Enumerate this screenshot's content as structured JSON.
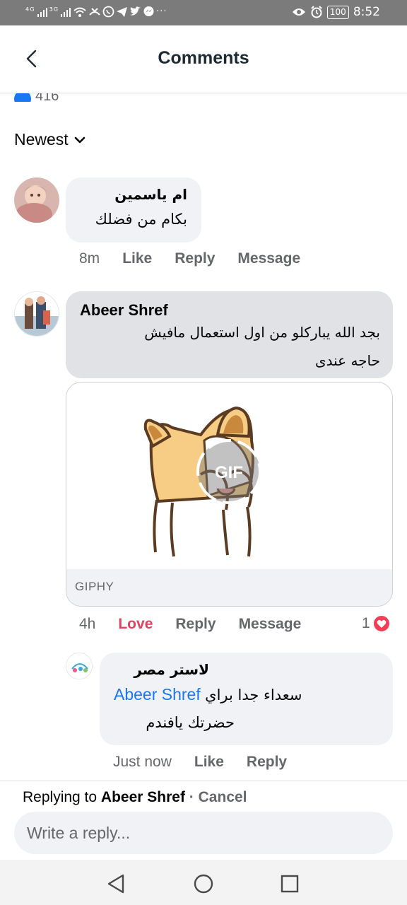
{
  "status_bar": {
    "network_left": "⁴ᴳ",
    "network_right": "³ᴳ",
    "battery": "100",
    "time": "8:52"
  },
  "header": {
    "title": "Comments"
  },
  "reactions": {
    "count": "416"
  },
  "sort": {
    "label": "Newest"
  },
  "comments": [
    {
      "author": "ام ياسمين",
      "text": "بكام من فضلك",
      "time": "8m",
      "like": "Like",
      "reply": "Reply",
      "message": "Message"
    },
    {
      "author": "Abeer Shref",
      "text_line1": "بجد الله يباركلو من اول استعمال مافيش",
      "text_line2": "حاجه عندى",
      "gif_source": "GIPHY",
      "gif_badge": "GIF",
      "time": "4h",
      "love": "Love",
      "reply": "Reply",
      "message": "Message",
      "reaction_count": "1"
    }
  ],
  "reply": {
    "author": "لاستر مصر",
    "mention": "Abeer Shref",
    "text_after_mention": "سعداء جدا براي",
    "text_line2": "حضرتك يافندم",
    "time": "Just now",
    "like": "Like",
    "reply": "Reply"
  },
  "composer": {
    "replying_prefix": "Replying to",
    "replying_to": "Abeer Shref",
    "separator": "·",
    "cancel": "Cancel",
    "placeholder": "Write a reply..."
  },
  "colors": {
    "accent": "#1877f2",
    "love": "#e4405f",
    "status_bar": "#7b7b7b",
    "bubble": "#f0f2f5"
  }
}
